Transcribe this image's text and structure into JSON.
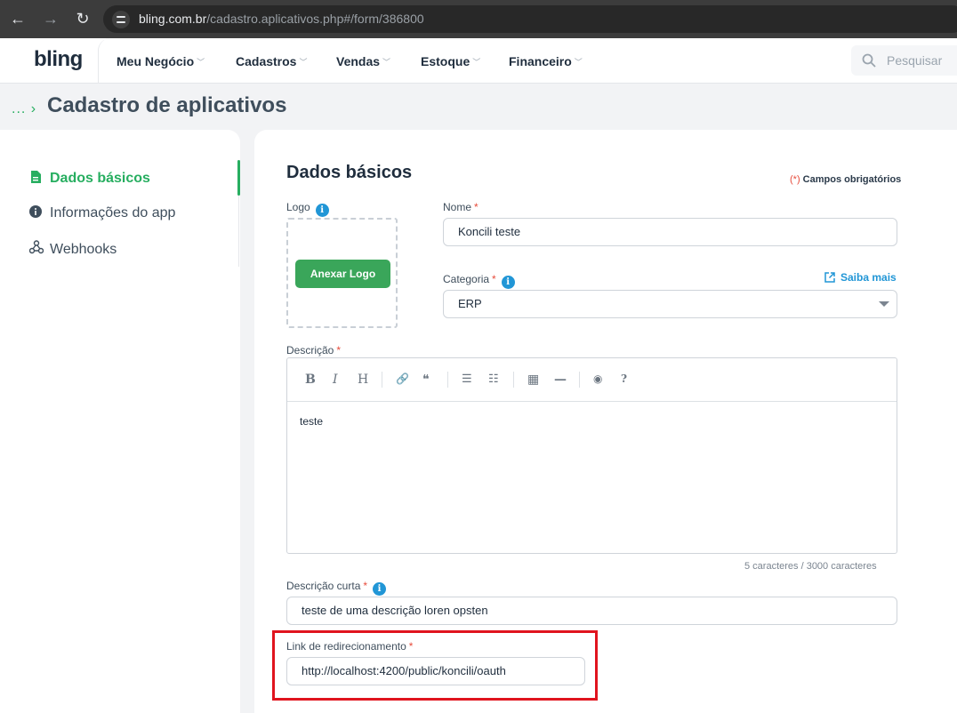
{
  "browser": {
    "url_domain": "bling.com.br",
    "url_path": "/cadastro.aplicativos.php#/form/386800",
    "back_icon": "arrow-left-icon",
    "forward_icon": "arrow-right-icon",
    "reload_icon": "reload-icon"
  },
  "header": {
    "logo": "bling",
    "menu": [
      {
        "label": "Meu Negócio"
      },
      {
        "label": "Cadastros"
      },
      {
        "label": "Vendas"
      },
      {
        "label": "Estoque"
      },
      {
        "label": "Financeiro"
      }
    ],
    "search_placeholder": "Pesquisar"
  },
  "breadcrumb": {
    "ellipsis": "...",
    "separator": "›",
    "title": "Cadastro de aplicativos"
  },
  "sidebar": {
    "items": [
      {
        "label": "Dados básicos",
        "icon": "document-icon",
        "active": true
      },
      {
        "label": "Informações do app",
        "icon": "info-icon",
        "active": false
      },
      {
        "label": "Webhooks",
        "icon": "webhook-icon",
        "active": false
      }
    ]
  },
  "form": {
    "heading": "Dados básicos",
    "required_mark": "(*)",
    "required_note": "Campos obrigatórios",
    "logo_label": "Logo",
    "attach_button": "Anexar Logo",
    "name_label": "Nome",
    "name_value": "Koncili teste",
    "category_label": "Categoria",
    "category_value": "ERP",
    "learn_more": "Saiba mais",
    "description_label": "Descrição",
    "description_value": "teste",
    "char_counter": "5 caracteres / 3000 caracteres",
    "short_description_label": "Descrição curta",
    "short_description_value": "teste de uma descrição loren opsten",
    "redirect_label": "Link de redirecionamento",
    "redirect_value": "http://localhost:4200/public/koncili/oauth",
    "star": "*",
    "info_glyph": "i"
  },
  "editor_toolbar": [
    {
      "name": "bold-icon",
      "glyph": "B"
    },
    {
      "name": "italic-icon",
      "glyph": "I"
    },
    {
      "name": "heading-icon",
      "glyph": "H"
    },
    {
      "name": "link-icon",
      "glyph": "🔗"
    },
    {
      "name": "quote-icon",
      "glyph": "❝"
    },
    {
      "name": "bullet-list-icon",
      "glyph": "☰"
    },
    {
      "name": "numbered-list-icon",
      "glyph": "☷"
    },
    {
      "name": "table-icon",
      "glyph": "▦"
    },
    {
      "name": "horizontal-rule-icon",
      "glyph": "—"
    },
    {
      "name": "preview-icon",
      "glyph": "◉"
    },
    {
      "name": "help-icon",
      "glyph": "?"
    }
  ],
  "colors": {
    "brand_green": "#27ae60",
    "info_blue": "#2196d6",
    "required_red": "#e74c3c",
    "highlight_red": "#e0141e"
  }
}
